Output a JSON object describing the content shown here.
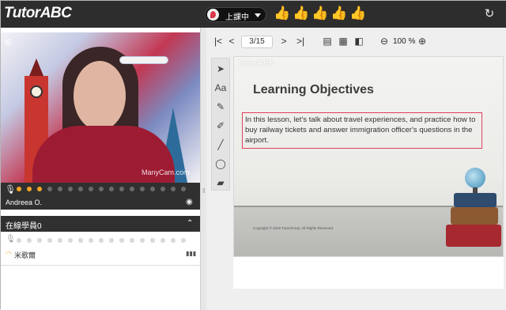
{
  "header": {
    "logo": "TutorABC",
    "status_label": "上課中",
    "thumbs": [
      {
        "name": "thumbs-up-icon-1",
        "active": true
      },
      {
        "name": "thumbs-up-icon-2",
        "active": false
      },
      {
        "name": "thumbs-up-icon-3",
        "active": false
      },
      {
        "name": "thumbs-up-icon-4",
        "active": false
      },
      {
        "name": "thumbs-up-icon-5",
        "active": false
      }
    ],
    "refresh_icon": "refresh-icon"
  },
  "video": {
    "presenter_name": "Andreea O.",
    "watermark": "ManyCam.com",
    "mic_icon": "mic-icon",
    "camera_icon": "camera-icon",
    "activity_dots": [
      true,
      true,
      true,
      false,
      false,
      false,
      false,
      false,
      false,
      false,
      false,
      false,
      false,
      false,
      false,
      false,
      false
    ]
  },
  "online": {
    "header": "在線學員0",
    "collapse_icon": "chevron-up-icon",
    "member": {
      "name": "米歌爾",
      "signal_icon": "wifi-icon"
    }
  },
  "toolbar": {
    "page_indicator": "3/15",
    "zoom_value": "100 %",
    "icons": [
      "first-page-icon",
      "prev-page-icon",
      "next-page-icon",
      "last-page-icon",
      "document-icon",
      "notes-icon",
      "bookmark-icon",
      "zoom-out-icon",
      "zoom-in-icon"
    ]
  },
  "tools": [
    "pointer-icon",
    "text-icon",
    "pen-icon",
    "marker-icon",
    "line-icon",
    "circle-icon",
    "eraser-icon"
  ],
  "slide": {
    "brand": "TutorABC",
    "title": "Learning Objectives",
    "body": "In this lesson, let's talk about travel experiences, and practice how to buy railway tickets and answer immigration officer's questions in the airport.",
    "copyright": "Copyright © 2016 TutorGroup. All Rights Reserved."
  },
  "colors": {
    "accent_red": "#e2313f",
    "orange_dot": "#f5a623",
    "header_bg": "#2d2d2d"
  }
}
